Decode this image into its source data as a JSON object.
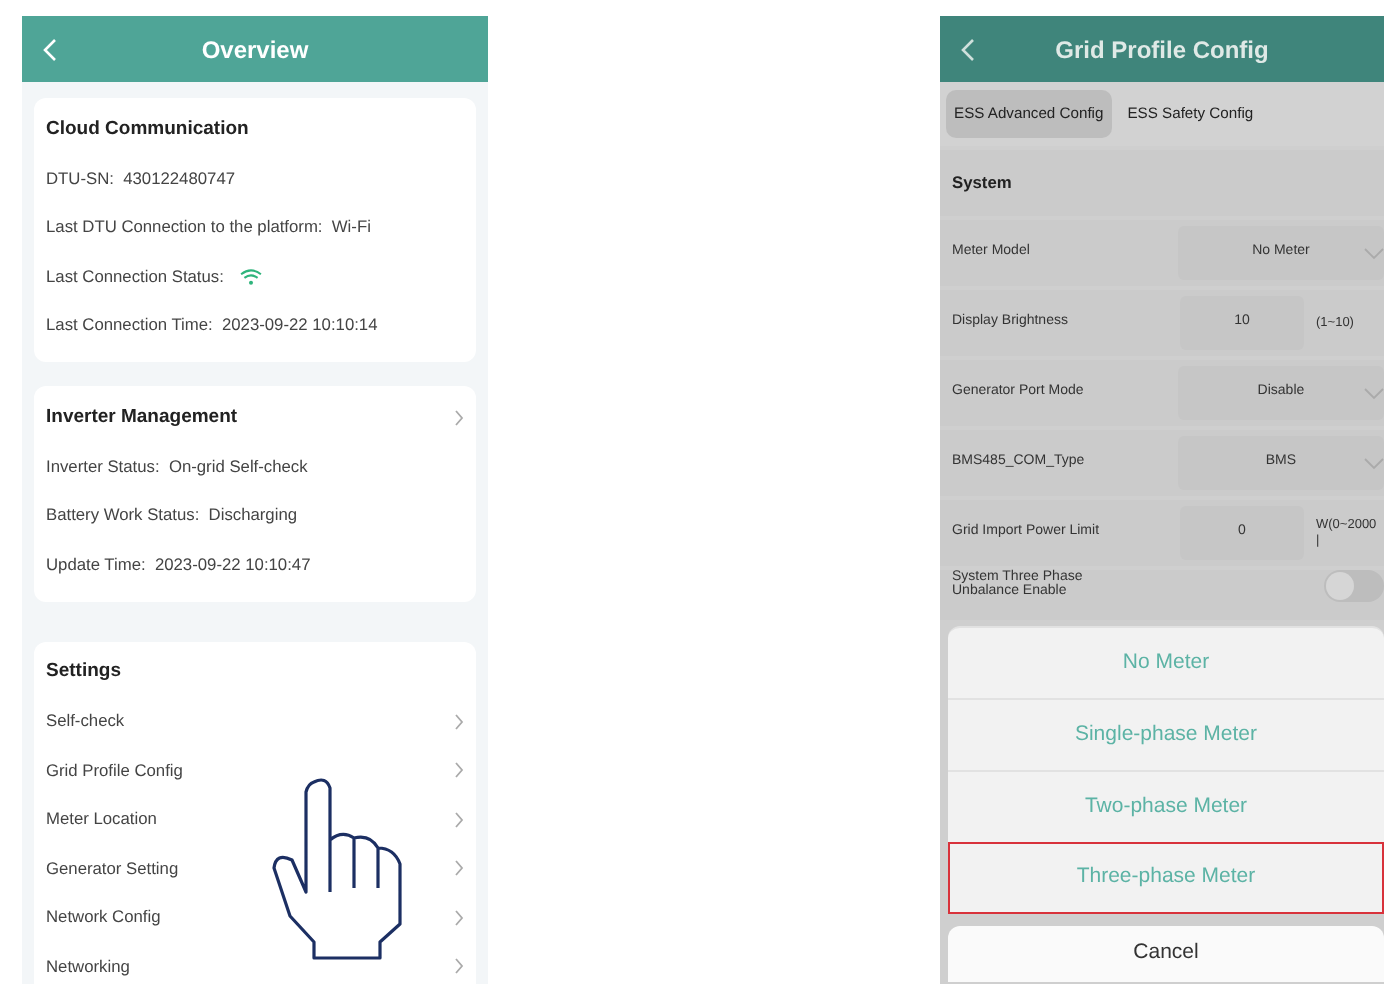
{
  "overview": {
    "title": "Overview",
    "cards": [
      {
        "title": "Cloud Communication",
        "has_chevron": false,
        "lines": [
          {
            "kind": "text",
            "label": "DTU-SN:",
            "value": "430122480747"
          },
          {
            "kind": "text",
            "label": "Last DTU Connection to the platform:",
            "value": "Wi-Fi"
          },
          {
            "kind": "wifi",
            "label": "Last Connection Status:"
          },
          {
            "kind": "text",
            "label": "Last Connection Time:",
            "value": "2023-09-22 10:10:14"
          }
        ]
      },
      {
        "title": "Inverter Management",
        "has_chevron": true,
        "lines": [
          {
            "kind": "text",
            "label": "Inverter Status:",
            "value": "On-grid Self-check"
          },
          {
            "kind": "text",
            "label": "Battery Work Status:",
            "value": "Discharging"
          },
          {
            "kind": "text",
            "label": "Update Time:",
            "value": "2023-09-22 10:10:47"
          }
        ]
      }
    ],
    "settings": {
      "title": "Settings",
      "items": [
        "Self-check",
        "Grid Profile Config",
        "Meter Location",
        "Generator Setting",
        "Network Config",
        "Networking"
      ]
    }
  },
  "grid_profile": {
    "title": "Grid Profile Config",
    "tabs": [
      {
        "label": "ESS Advanced Config",
        "selected": true
      },
      {
        "label": "ESS Safety Config",
        "selected": false
      }
    ],
    "section": "System",
    "rows": [
      {
        "kind": "select",
        "label": "Meter Model",
        "value": "No Meter"
      },
      {
        "kind": "input",
        "label": "Display Brightness",
        "value": "10",
        "unit": "(1~10)"
      },
      {
        "kind": "select",
        "label": "Generator Port Mode",
        "value": "Disable"
      },
      {
        "kind": "select",
        "label": "BMS485_COM_Type",
        "value": "BMS"
      },
      {
        "kind": "input",
        "label": "Grid Import Power Limit",
        "value": "0",
        "unit": "W(0~2000\n|"
      },
      {
        "kind": "toggle",
        "label": "System Three Phase Unbalance Enable",
        "on": false
      }
    ],
    "sheet": {
      "options": [
        {
          "label": "No Meter",
          "highlighted": false
        },
        {
          "label": "Single-phase Meter",
          "highlighted": false
        },
        {
          "label": "Two-phase Meter",
          "highlighted": false
        },
        {
          "label": "Three-phase Meter",
          "highlighted": true
        }
      ],
      "cancel": "Cancel"
    }
  }
}
